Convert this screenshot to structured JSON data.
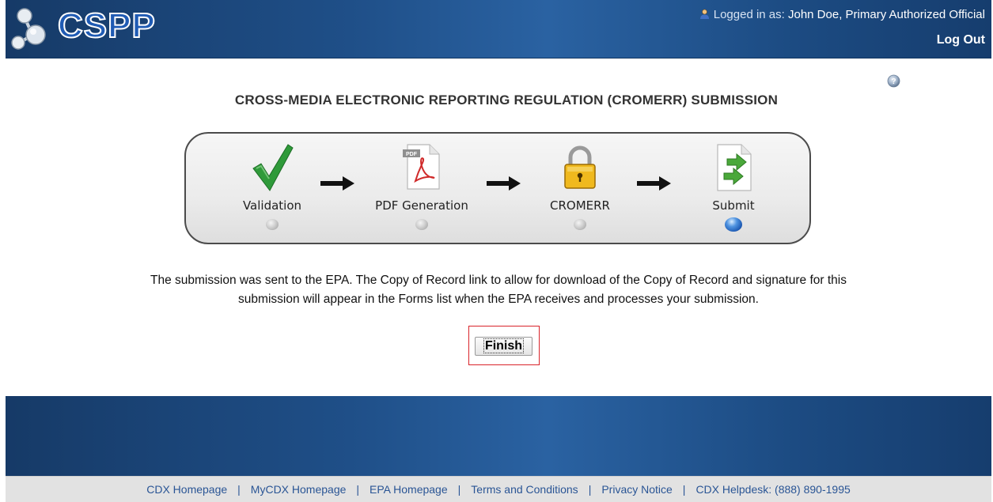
{
  "header": {
    "logo_text": "CSPP",
    "logged_in_prefix": "Logged in as:",
    "user_name": "John Doe, Primary Authorized Official",
    "logout_label": "Log Out"
  },
  "main": {
    "title": "CROSS-MEDIA ELECTRONIC REPORTING REGULATION (CROMERR) SUBMISSION",
    "steps": [
      {
        "label": "Validation",
        "icon": "checkmark-icon",
        "active": false
      },
      {
        "label": "PDF Generation",
        "icon": "pdf-file-icon",
        "active": false
      },
      {
        "label": "CROMERR",
        "icon": "padlock-icon",
        "active": false
      },
      {
        "label": "Submit",
        "icon": "submit-document-icon",
        "active": true
      }
    ],
    "message_line1": "The submission was sent to the EPA. The Copy of Record link to allow for download of the Copy of Record and signature for this",
    "message_line2": "submission will appear in the Forms list when the EPA receives and processes your submission.",
    "finish_label": "Finish"
  },
  "footer": {
    "links": [
      "CDX Homepage",
      "MyCDX Homepage",
      "EPA Homepage",
      "Terms and Conditions",
      "Privacy Notice",
      "CDX Helpdesk: (888) 890-1995"
    ]
  },
  "colors": {
    "header_blue": "#1f4f88",
    "highlight_red": "#d9242a",
    "active_step_blue": "#1a56b0",
    "link_blue": "#2a5595"
  }
}
